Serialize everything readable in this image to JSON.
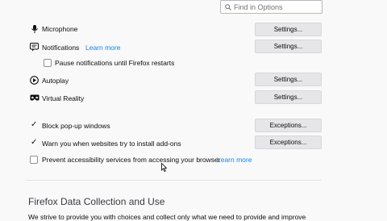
{
  "search": {
    "placeholder": "Find in Options"
  },
  "permissions": {
    "microphone_label": "Microphone",
    "notifications_label": "Notifications",
    "notifications_learn_more": "Learn more",
    "pause_notifications_label": "Pause notifications until Firefox restarts",
    "autoplay_label": "Autoplay",
    "vr_label": "Virtual Reality",
    "settings_label": "Settings..."
  },
  "options": {
    "block_popups_label": "Block pop-up windows",
    "block_popups_checked": true,
    "warn_addons_label": "Warn you when websites try to install add-ons",
    "warn_addons_checked": true,
    "accessibility_label": "Prevent accessibility services from accessing your browser",
    "accessibility_checked": false,
    "accessibility_learn_more": "Learn more",
    "exceptions_label": "Exceptions..."
  },
  "data_collection": {
    "heading": "Firefox Data Collection and Use",
    "intro_text": "We strive to provide you with choices and collect only what we need to provide and improve"
  },
  "icons": [
    "search-icon",
    "microphone-icon",
    "notifications-icon",
    "autoplay-icon",
    "vr-icon",
    "checkmark-icon"
  ],
  "colors": {
    "accent": "#0a84ff",
    "background": "#f9f9fa",
    "button": "#e6e6e9"
  }
}
